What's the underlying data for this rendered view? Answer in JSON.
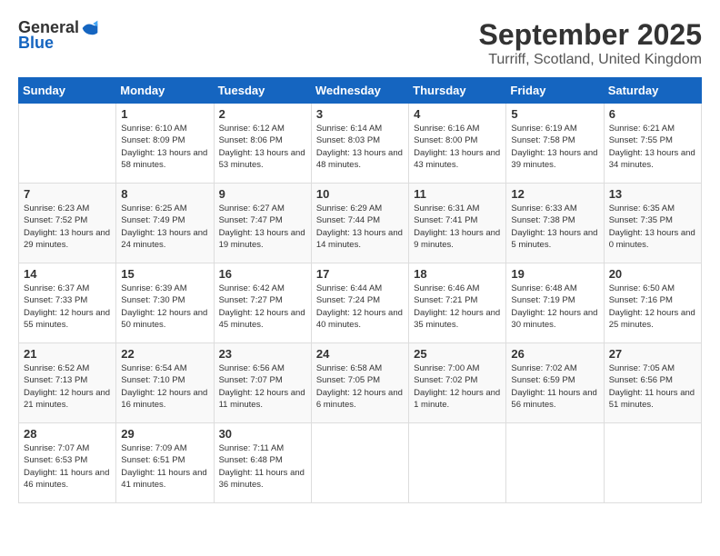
{
  "header": {
    "logo_general": "General",
    "logo_blue": "Blue",
    "month_title": "September 2025",
    "location": "Turriff, Scotland, United Kingdom"
  },
  "days_of_week": [
    "Sunday",
    "Monday",
    "Tuesday",
    "Wednesday",
    "Thursday",
    "Friday",
    "Saturday"
  ],
  "weeks": [
    [
      {
        "day": "",
        "sunrise": "",
        "sunset": "",
        "daylight": ""
      },
      {
        "day": "1",
        "sunrise": "Sunrise: 6:10 AM",
        "sunset": "Sunset: 8:09 PM",
        "daylight": "Daylight: 13 hours and 58 minutes."
      },
      {
        "day": "2",
        "sunrise": "Sunrise: 6:12 AM",
        "sunset": "Sunset: 8:06 PM",
        "daylight": "Daylight: 13 hours and 53 minutes."
      },
      {
        "day": "3",
        "sunrise": "Sunrise: 6:14 AM",
        "sunset": "Sunset: 8:03 PM",
        "daylight": "Daylight: 13 hours and 48 minutes."
      },
      {
        "day": "4",
        "sunrise": "Sunrise: 6:16 AM",
        "sunset": "Sunset: 8:00 PM",
        "daylight": "Daylight: 13 hours and 43 minutes."
      },
      {
        "day": "5",
        "sunrise": "Sunrise: 6:19 AM",
        "sunset": "Sunset: 7:58 PM",
        "daylight": "Daylight: 13 hours and 39 minutes."
      },
      {
        "day": "6",
        "sunrise": "Sunrise: 6:21 AM",
        "sunset": "Sunset: 7:55 PM",
        "daylight": "Daylight: 13 hours and 34 minutes."
      }
    ],
    [
      {
        "day": "7",
        "sunrise": "Sunrise: 6:23 AM",
        "sunset": "Sunset: 7:52 PM",
        "daylight": "Daylight: 13 hours and 29 minutes."
      },
      {
        "day": "8",
        "sunrise": "Sunrise: 6:25 AM",
        "sunset": "Sunset: 7:49 PM",
        "daylight": "Daylight: 13 hours and 24 minutes."
      },
      {
        "day": "9",
        "sunrise": "Sunrise: 6:27 AM",
        "sunset": "Sunset: 7:47 PM",
        "daylight": "Daylight: 13 hours and 19 minutes."
      },
      {
        "day": "10",
        "sunrise": "Sunrise: 6:29 AM",
        "sunset": "Sunset: 7:44 PM",
        "daylight": "Daylight: 13 hours and 14 minutes."
      },
      {
        "day": "11",
        "sunrise": "Sunrise: 6:31 AM",
        "sunset": "Sunset: 7:41 PM",
        "daylight": "Daylight: 13 hours and 9 minutes."
      },
      {
        "day": "12",
        "sunrise": "Sunrise: 6:33 AM",
        "sunset": "Sunset: 7:38 PM",
        "daylight": "Daylight: 13 hours and 5 minutes."
      },
      {
        "day": "13",
        "sunrise": "Sunrise: 6:35 AM",
        "sunset": "Sunset: 7:35 PM",
        "daylight": "Daylight: 13 hours and 0 minutes."
      }
    ],
    [
      {
        "day": "14",
        "sunrise": "Sunrise: 6:37 AM",
        "sunset": "Sunset: 7:33 PM",
        "daylight": "Daylight: 12 hours and 55 minutes."
      },
      {
        "day": "15",
        "sunrise": "Sunrise: 6:39 AM",
        "sunset": "Sunset: 7:30 PM",
        "daylight": "Daylight: 12 hours and 50 minutes."
      },
      {
        "day": "16",
        "sunrise": "Sunrise: 6:42 AM",
        "sunset": "Sunset: 7:27 PM",
        "daylight": "Daylight: 12 hours and 45 minutes."
      },
      {
        "day": "17",
        "sunrise": "Sunrise: 6:44 AM",
        "sunset": "Sunset: 7:24 PM",
        "daylight": "Daylight: 12 hours and 40 minutes."
      },
      {
        "day": "18",
        "sunrise": "Sunrise: 6:46 AM",
        "sunset": "Sunset: 7:21 PM",
        "daylight": "Daylight: 12 hours and 35 minutes."
      },
      {
        "day": "19",
        "sunrise": "Sunrise: 6:48 AM",
        "sunset": "Sunset: 7:19 PM",
        "daylight": "Daylight: 12 hours and 30 minutes."
      },
      {
        "day": "20",
        "sunrise": "Sunrise: 6:50 AM",
        "sunset": "Sunset: 7:16 PM",
        "daylight": "Daylight: 12 hours and 25 minutes."
      }
    ],
    [
      {
        "day": "21",
        "sunrise": "Sunrise: 6:52 AM",
        "sunset": "Sunset: 7:13 PM",
        "daylight": "Daylight: 12 hours and 21 minutes."
      },
      {
        "day": "22",
        "sunrise": "Sunrise: 6:54 AM",
        "sunset": "Sunset: 7:10 PM",
        "daylight": "Daylight: 12 hours and 16 minutes."
      },
      {
        "day": "23",
        "sunrise": "Sunrise: 6:56 AM",
        "sunset": "Sunset: 7:07 PM",
        "daylight": "Daylight: 12 hours and 11 minutes."
      },
      {
        "day": "24",
        "sunrise": "Sunrise: 6:58 AM",
        "sunset": "Sunset: 7:05 PM",
        "daylight": "Daylight: 12 hours and 6 minutes."
      },
      {
        "day": "25",
        "sunrise": "Sunrise: 7:00 AM",
        "sunset": "Sunset: 7:02 PM",
        "daylight": "Daylight: 12 hours and 1 minute."
      },
      {
        "day": "26",
        "sunrise": "Sunrise: 7:02 AM",
        "sunset": "Sunset: 6:59 PM",
        "daylight": "Daylight: 11 hours and 56 minutes."
      },
      {
        "day": "27",
        "sunrise": "Sunrise: 7:05 AM",
        "sunset": "Sunset: 6:56 PM",
        "daylight": "Daylight: 11 hours and 51 minutes."
      }
    ],
    [
      {
        "day": "28",
        "sunrise": "Sunrise: 7:07 AM",
        "sunset": "Sunset: 6:53 PM",
        "daylight": "Daylight: 11 hours and 46 minutes."
      },
      {
        "day": "29",
        "sunrise": "Sunrise: 7:09 AM",
        "sunset": "Sunset: 6:51 PM",
        "daylight": "Daylight: 11 hours and 41 minutes."
      },
      {
        "day": "30",
        "sunrise": "Sunrise: 7:11 AM",
        "sunset": "Sunset: 6:48 PM",
        "daylight": "Daylight: 11 hours and 36 minutes."
      },
      {
        "day": "",
        "sunrise": "",
        "sunset": "",
        "daylight": ""
      },
      {
        "day": "",
        "sunrise": "",
        "sunset": "",
        "daylight": ""
      },
      {
        "day": "",
        "sunrise": "",
        "sunset": "",
        "daylight": ""
      },
      {
        "day": "",
        "sunrise": "",
        "sunset": "",
        "daylight": ""
      }
    ]
  ]
}
